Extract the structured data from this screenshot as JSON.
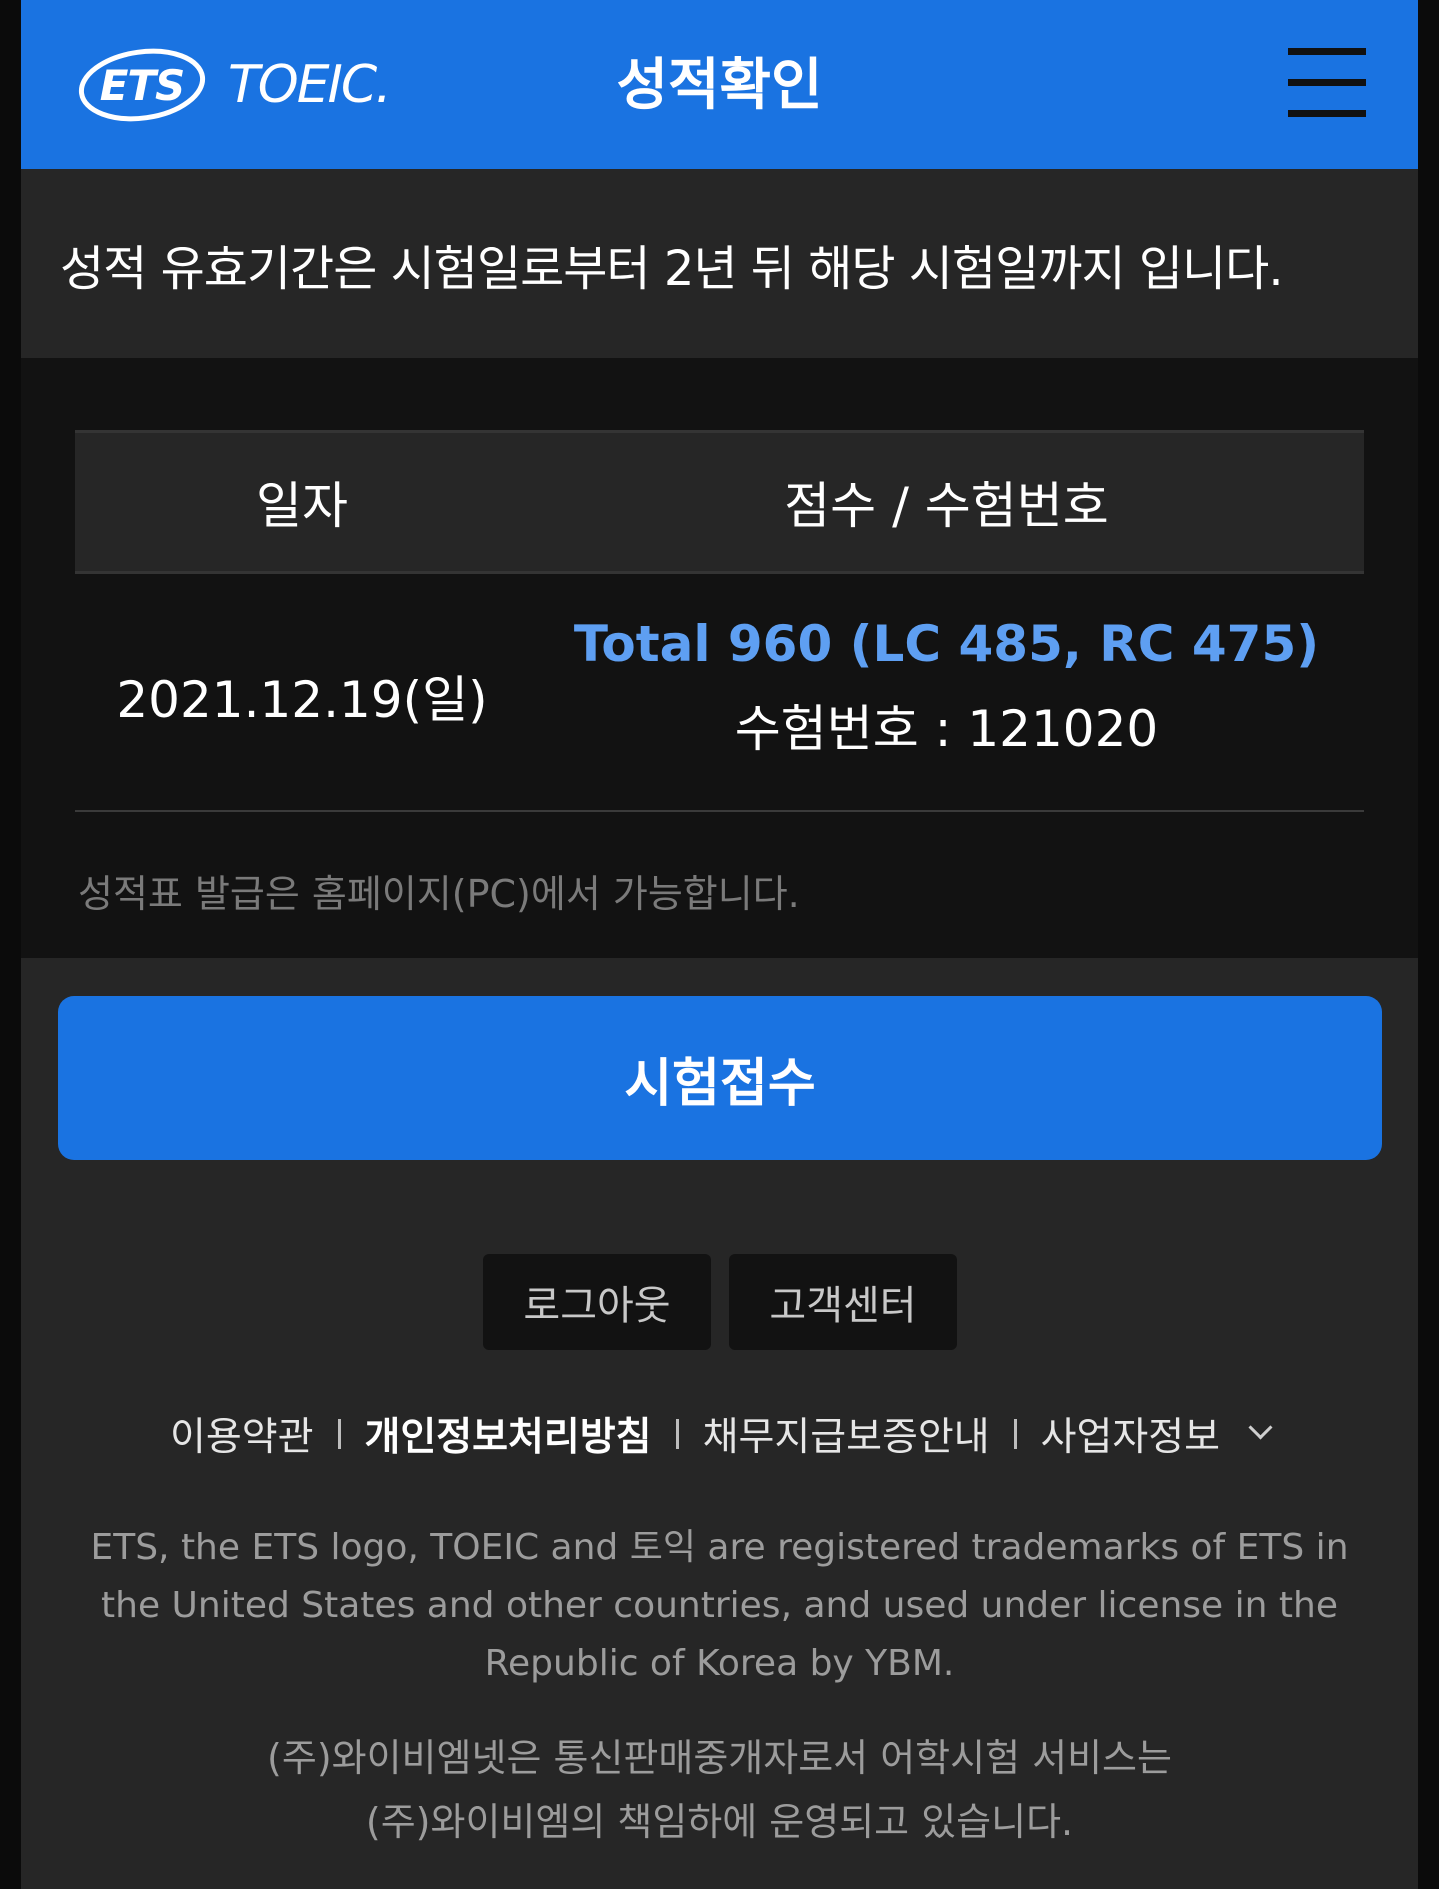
{
  "header": {
    "logo_ets": "ETS",
    "logo_toeic": "TOEIC.",
    "title": "성적확인"
  },
  "notice": "성적 유효기간은 시험일로부터 2년 뒤 해당 시험일까지 입니다.",
  "table": {
    "headers": [
      "일자",
      "점수 / 수험번호"
    ],
    "rows": [
      {
        "date": "2021.12.19(일)",
        "score": "Total 960 (LC 485, RC 475)",
        "exam_number": "수험번호 : 121020"
      }
    ]
  },
  "issue_note": "성적표 발급은 홈페이지(PC)에서 가능합니다.",
  "register_button": "시험접수",
  "small_buttons": {
    "logout": "로그아웃",
    "support": "고객센터"
  },
  "footer_links": {
    "terms": "이용약관",
    "privacy": "개인정보처리방침",
    "guarantee": "채무지급보증안내",
    "business": "사업자정보"
  },
  "trademark": "ETS, the ETS logo, TOEIC and 토익 are registered trademarks of ETS in the United States and other countries, and used under license in the Republic of Korea by YBM.",
  "operator": {
    "line1": "(주)와이비엠넷은 통신판매중개자로서 어학시험 서비스는",
    "line2": "(주)와이비엠의 책임하에 운영되고 있습니다."
  },
  "colors": {
    "brand_blue": "#1a73e1",
    "score_blue": "#5e9ff2",
    "background": "#262626",
    "panel": "#121212"
  },
  "icons": [
    "hamburger-menu-icon",
    "chevron-down-icon"
  ]
}
